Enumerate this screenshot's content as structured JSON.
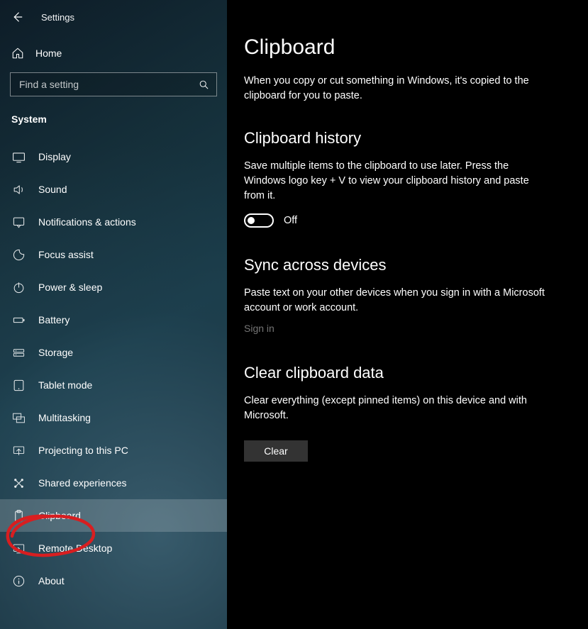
{
  "header": {
    "app_title": "Settings"
  },
  "sidebar": {
    "home_label": "Home",
    "search_placeholder": "Find a setting",
    "category": "System",
    "items": [
      {
        "label": "Display",
        "icon": "display"
      },
      {
        "label": "Sound",
        "icon": "sound"
      },
      {
        "label": "Notifications & actions",
        "icon": "notifications"
      },
      {
        "label": "Focus assist",
        "icon": "focus"
      },
      {
        "label": "Power & sleep",
        "icon": "power"
      },
      {
        "label": "Battery",
        "icon": "battery"
      },
      {
        "label": "Storage",
        "icon": "storage"
      },
      {
        "label": "Tablet mode",
        "icon": "tablet"
      },
      {
        "label": "Multitasking",
        "icon": "multitask"
      },
      {
        "label": "Projecting to this PC",
        "icon": "project"
      },
      {
        "label": "Shared experiences",
        "icon": "shared"
      },
      {
        "label": "Clipboard",
        "icon": "clipboard",
        "selected": true
      },
      {
        "label": "Remote Desktop",
        "icon": "remote"
      },
      {
        "label": "About",
        "icon": "about"
      }
    ]
  },
  "main": {
    "title": "Clipboard",
    "intro": "When you copy or cut something in Windows, it's copied to the clipboard for you to paste.",
    "history": {
      "heading": "Clipboard history",
      "body": "Save multiple items to the clipboard to use later. Press the Windows logo key + V to view your clipboard history and paste from it.",
      "toggle_state": "Off"
    },
    "sync": {
      "heading": "Sync across devices",
      "body": "Paste text on your other devices when you sign in with a Microsoft account or work account.",
      "link": "Sign in"
    },
    "clear": {
      "heading": "Clear clipboard data",
      "body": "Clear everything (except pinned items) on this device and with Microsoft.",
      "button": "Clear"
    }
  }
}
